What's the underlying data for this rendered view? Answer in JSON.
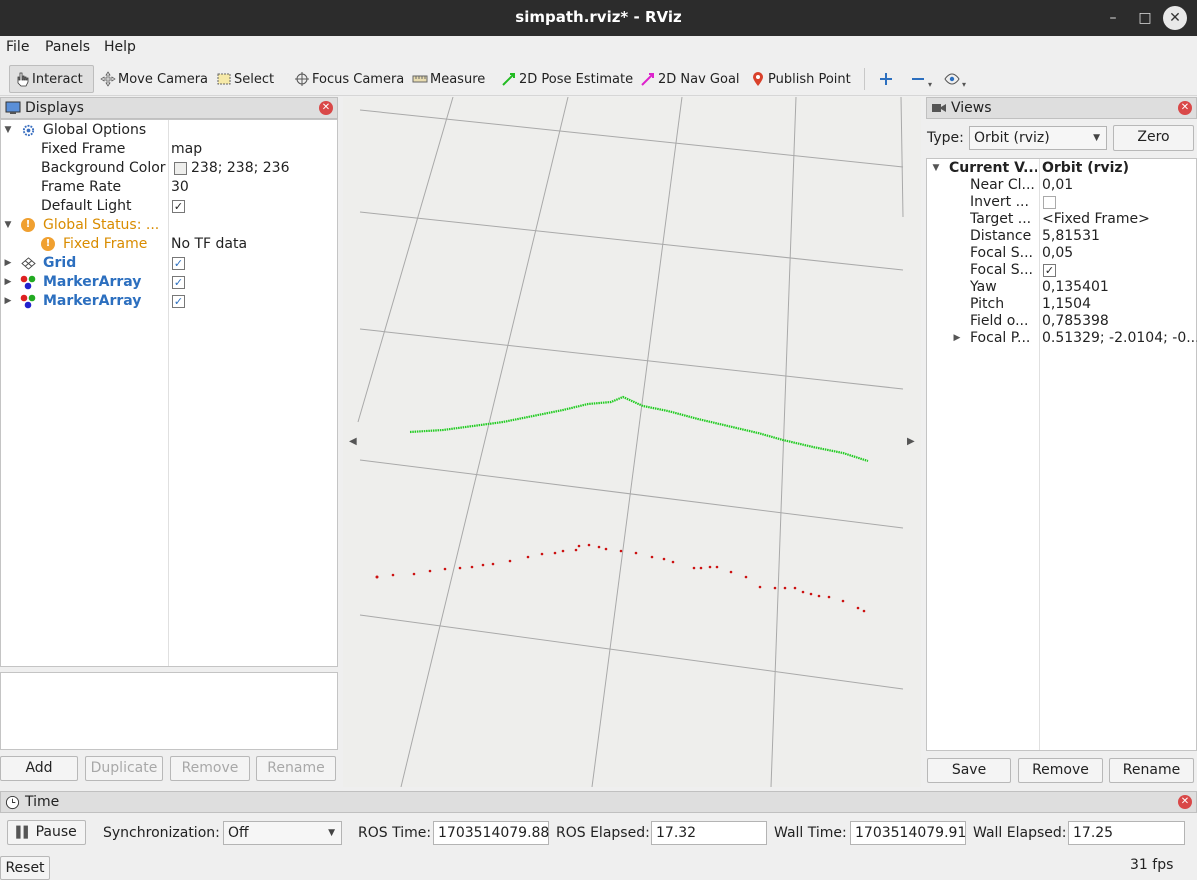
{
  "window": {
    "title": "simpath.rviz* - RViz",
    "minimize": "–",
    "maximize": "□",
    "close": "✕"
  },
  "menu": {
    "file": "File",
    "panels": "Panels",
    "help": "Help"
  },
  "toolbar": {
    "interact": "Interact",
    "move_camera": "Move Camera",
    "select": "Select",
    "focus_camera": "Focus Camera",
    "measure": "Measure",
    "pose_estimate": "2D Pose Estimate",
    "nav_goal": "2D Nav Goal",
    "publish_point": "Publish Point"
  },
  "displays": {
    "title": "Displays",
    "global_options": "Global Options",
    "fixed_frame_label": "Fixed Frame",
    "fixed_frame_value": "map",
    "bg_color_label": "Background Color",
    "bg_color_value": "238; 238; 236",
    "frame_rate_label": "Frame Rate",
    "frame_rate_value": "30",
    "default_light_label": "Default Light",
    "global_status": "Global Status: ...",
    "status_fixed_frame": "Fixed Frame",
    "status_value": "No TF data",
    "grid": "Grid",
    "marker1": "MarkerArray",
    "marker2": "MarkerArray",
    "add": "Add",
    "duplicate": "Duplicate",
    "remove": "Remove",
    "rename": "Rename"
  },
  "views": {
    "title": "Views",
    "type_label": "Type:",
    "type_value": "Orbit (rviz)",
    "zero": "Zero",
    "current_key": "Current V...",
    "current_value": "Orbit (rviz)",
    "rows": [
      {
        "k": "Near Cl...",
        "v": "0,01"
      },
      {
        "k": "Invert ...",
        "v": ""
      },
      {
        "k": "Target ...",
        "v": "<Fixed Frame>"
      },
      {
        "k": "Distance",
        "v": "5,81531"
      },
      {
        "k": "Focal S...",
        "v": "0,05"
      },
      {
        "k": "Focal S...",
        "v": ""
      },
      {
        "k": "Yaw",
        "v": "0,135401"
      },
      {
        "k": "Pitch",
        "v": "1,1504"
      },
      {
        "k": "Field o...",
        "v": "0,785398"
      },
      {
        "k": "Focal P...",
        "v": "0.51329; -2.0104; -0...."
      }
    ],
    "save": "Save",
    "remove": "Remove",
    "rename": "Rename"
  },
  "time": {
    "title": "Time",
    "pause": "Pause",
    "sync_label": "Synchronization:",
    "sync_value": "Off",
    "ros_time_label": "ROS Time:",
    "ros_time": "1703514079.88",
    "ros_elapsed_label": "ROS Elapsed:",
    "ros_elapsed": "17.32",
    "wall_time_label": "Wall Time:",
    "wall_time": "1703514079.91",
    "wall_elapsed_label": "Wall Elapsed:",
    "wall_elapsed": "17.25",
    "reset": "Reset",
    "fps": "31 fps"
  },
  "colors": {
    "green_path": "#22cc22",
    "red_markers": "#cc1111",
    "grid": "#a0a0a0",
    "link_blue": "#2c6fbf",
    "warning": "#d98c00"
  }
}
